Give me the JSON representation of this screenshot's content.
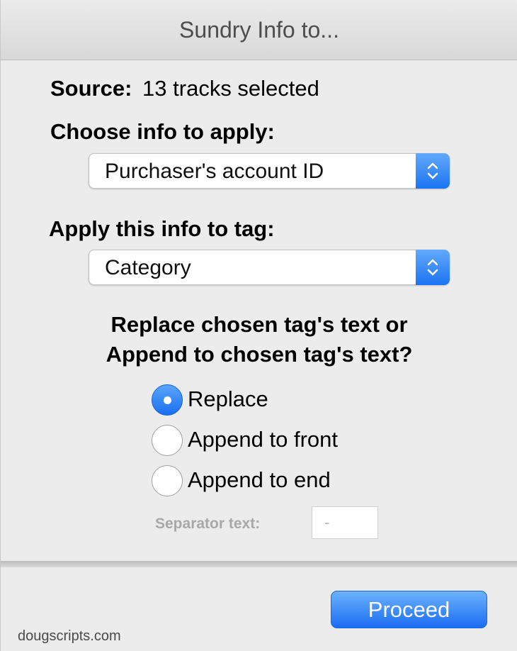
{
  "window": {
    "title": "Sundry Info to..."
  },
  "source": {
    "label": "Source:",
    "value": "13 tracks selected"
  },
  "choose_info": {
    "label": "Choose info to apply:",
    "selected": "Purchaser's account ID"
  },
  "apply_tag": {
    "label": "Apply this info to tag:",
    "selected": "Category"
  },
  "mode": {
    "question_line1": "Replace chosen tag's text or",
    "question_line2": "Append to chosen tag's text?",
    "options": [
      {
        "label": "Replace",
        "selected": true
      },
      {
        "label": "Append to front",
        "selected": false
      },
      {
        "label": "Append to end",
        "selected": false
      }
    ]
  },
  "separator": {
    "label": "Separator text:",
    "value": "-"
  },
  "buttons": {
    "proceed": "Proceed"
  },
  "footer": {
    "text": "dougscripts.com"
  },
  "colors": {
    "accent": "#1c74f2",
    "window_bg": "#ececec"
  }
}
